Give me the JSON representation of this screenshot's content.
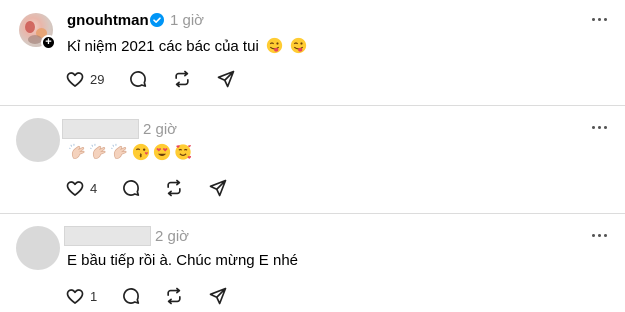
{
  "posts": [
    {
      "username": "gnouhtman",
      "verified": true,
      "time": "1 giờ",
      "text": "Kỉ niệm 2021 các bác của tui",
      "likes": "29"
    },
    {
      "username": "",
      "time": "2 giờ",
      "emojis": [
        "clap-light",
        "clap-light",
        "clap-light",
        "kissing-wink",
        "heart-eyes",
        "hugging-hearts"
      ],
      "likes": "4"
    },
    {
      "username": "",
      "time": "2 giờ",
      "text": "E bầu tiếp rồi à. Chúc mừng E nhé",
      "likes": "1"
    }
  ],
  "icons": {
    "like": "heart-icon",
    "reply": "comment-icon",
    "repost": "repost-icon",
    "share": "share-icon",
    "more": "more-icon"
  },
  "colors": {
    "verified": "#0095f6",
    "muted": "#999999",
    "divider": "#dcdcdc",
    "emoji_face": "#ffcc33"
  }
}
